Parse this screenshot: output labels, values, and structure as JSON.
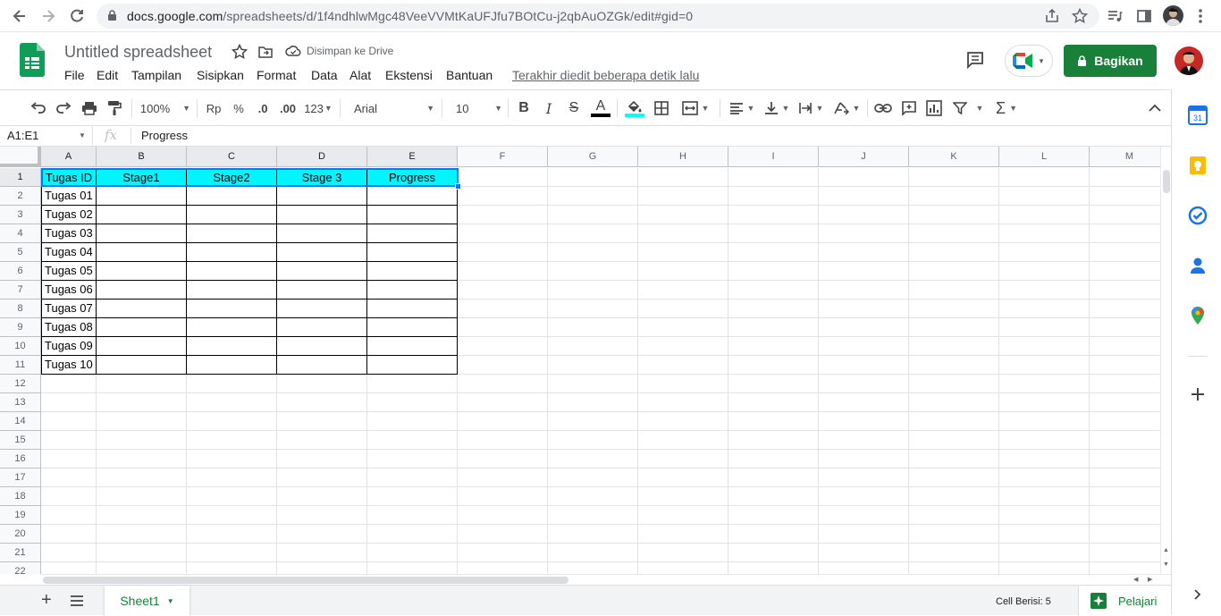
{
  "browser": {
    "url_host": "docs.google.com",
    "url_path": "/spreadsheets/d/1f4ndhlwMgc48VeeVVMtKaUFJfu7BOtCu-j2qbAuOZGk/edit#gid=0"
  },
  "header": {
    "title": "Untitled spreadsheet",
    "saved_status": "Disimpan ke Drive",
    "menu": [
      "File",
      "Edit",
      "Tampilan",
      "Sisipkan",
      "Format",
      "Data",
      "Alat",
      "Ekstensi",
      "Bantuan"
    ],
    "last_edit": "Terakhir diedit beberapa detik lalu",
    "share_label": "Bagikan"
  },
  "toolbar": {
    "zoom": "100%",
    "currency": "Rp",
    "percent": "%",
    "dec_decrease": ".0",
    "dec_increase": ".00",
    "more_formats": "123",
    "font": "Arial",
    "font_size": "10",
    "bold": "B",
    "italic": "I",
    "strike": "S",
    "text_color": "A"
  },
  "formula_bar": {
    "name_box": "A1:E1",
    "fx": "fx",
    "value": "Progress"
  },
  "grid": {
    "columns": [
      "A",
      "B",
      "C",
      "D",
      "E",
      "F",
      "G",
      "H",
      "I",
      "J",
      "K",
      "L",
      "M"
    ],
    "rows": [
      "1",
      "2",
      "3",
      "4",
      "5",
      "6",
      "7",
      "8",
      "9",
      "10",
      "11",
      "12",
      "13",
      "14",
      "15",
      "16",
      "17",
      "18",
      "19",
      "20",
      "21",
      "22"
    ],
    "header_row": [
      "Tugas ID",
      "Stage1",
      "Stage2",
      "Stage 3",
      "Progress"
    ],
    "task_ids": [
      "Tugas 01",
      "Tugas 02",
      "Tugas 03",
      "Tugas 04",
      "Tugas 05",
      "Tugas 06",
      "Tugas 07",
      "Tugas 08",
      "Tugas 09",
      "Tugas 10"
    ]
  },
  "colors": {
    "header_fill": "#00ffff",
    "selection": "#1a73e8",
    "brand_green": "#188038"
  },
  "bottom": {
    "sheet_name": "Sheet1",
    "cell_count": "Cell Berisi: 5",
    "explore": "Pelajari"
  },
  "side_panel": {
    "calendar_day": "31",
    "icons": [
      "calendar-icon",
      "keep-icon",
      "tasks-icon",
      "contacts-icon",
      "maps-icon",
      "add-icon",
      "expand-icon"
    ]
  }
}
